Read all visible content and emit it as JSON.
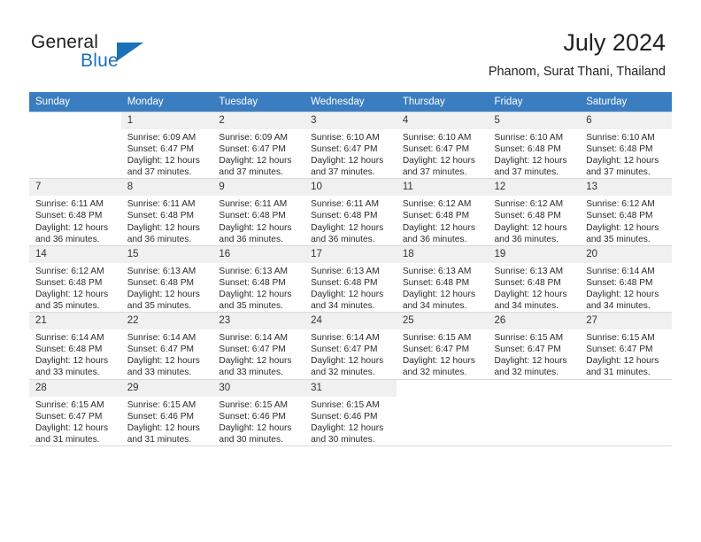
{
  "brand": {
    "word_one": "General",
    "word_two": "Blue",
    "accent_color": "#1b71b8"
  },
  "header": {
    "title": "July 2024",
    "location": "Phanom, Surat Thani, Thailand",
    "header_bg": "#3a7dc0"
  },
  "weekdays": [
    "Sunday",
    "Monday",
    "Tuesday",
    "Wednesday",
    "Thursday",
    "Friday",
    "Saturday"
  ],
  "labels": {
    "sunrise_prefix": "Sunrise:",
    "sunset_prefix": "Sunset:",
    "daylight_prefix": "Daylight:"
  },
  "weeks": [
    [
      {
        "day": "",
        "sunrise": "",
        "sunset": "",
        "daylight_line1": "",
        "daylight_line2": ""
      },
      {
        "day": "1",
        "sunrise": "Sunrise: 6:09 AM",
        "sunset": "Sunset: 6:47 PM",
        "daylight_line1": "Daylight: 12 hours",
        "daylight_line2": "and 37 minutes."
      },
      {
        "day": "2",
        "sunrise": "Sunrise: 6:09 AM",
        "sunset": "Sunset: 6:47 PM",
        "daylight_line1": "Daylight: 12 hours",
        "daylight_line2": "and 37 minutes."
      },
      {
        "day": "3",
        "sunrise": "Sunrise: 6:10 AM",
        "sunset": "Sunset: 6:47 PM",
        "daylight_line1": "Daylight: 12 hours",
        "daylight_line2": "and 37 minutes."
      },
      {
        "day": "4",
        "sunrise": "Sunrise: 6:10 AM",
        "sunset": "Sunset: 6:47 PM",
        "daylight_line1": "Daylight: 12 hours",
        "daylight_line2": "and 37 minutes."
      },
      {
        "day": "5",
        "sunrise": "Sunrise: 6:10 AM",
        "sunset": "Sunset: 6:48 PM",
        "daylight_line1": "Daylight: 12 hours",
        "daylight_line2": "and 37 minutes."
      },
      {
        "day": "6",
        "sunrise": "Sunrise: 6:10 AM",
        "sunset": "Sunset: 6:48 PM",
        "daylight_line1": "Daylight: 12 hours",
        "daylight_line2": "and 37 minutes."
      }
    ],
    [
      {
        "day": "7",
        "sunrise": "Sunrise: 6:11 AM",
        "sunset": "Sunset: 6:48 PM",
        "daylight_line1": "Daylight: 12 hours",
        "daylight_line2": "and 36 minutes."
      },
      {
        "day": "8",
        "sunrise": "Sunrise: 6:11 AM",
        "sunset": "Sunset: 6:48 PM",
        "daylight_line1": "Daylight: 12 hours",
        "daylight_line2": "and 36 minutes."
      },
      {
        "day": "9",
        "sunrise": "Sunrise: 6:11 AM",
        "sunset": "Sunset: 6:48 PM",
        "daylight_line1": "Daylight: 12 hours",
        "daylight_line2": "and 36 minutes."
      },
      {
        "day": "10",
        "sunrise": "Sunrise: 6:11 AM",
        "sunset": "Sunset: 6:48 PM",
        "daylight_line1": "Daylight: 12 hours",
        "daylight_line2": "and 36 minutes."
      },
      {
        "day": "11",
        "sunrise": "Sunrise: 6:12 AM",
        "sunset": "Sunset: 6:48 PM",
        "daylight_line1": "Daylight: 12 hours",
        "daylight_line2": "and 36 minutes."
      },
      {
        "day": "12",
        "sunrise": "Sunrise: 6:12 AM",
        "sunset": "Sunset: 6:48 PM",
        "daylight_line1": "Daylight: 12 hours",
        "daylight_line2": "and 36 minutes."
      },
      {
        "day": "13",
        "sunrise": "Sunrise: 6:12 AM",
        "sunset": "Sunset: 6:48 PM",
        "daylight_line1": "Daylight: 12 hours",
        "daylight_line2": "and 35 minutes."
      }
    ],
    [
      {
        "day": "14",
        "sunrise": "Sunrise: 6:12 AM",
        "sunset": "Sunset: 6:48 PM",
        "daylight_line1": "Daylight: 12 hours",
        "daylight_line2": "and 35 minutes."
      },
      {
        "day": "15",
        "sunrise": "Sunrise: 6:13 AM",
        "sunset": "Sunset: 6:48 PM",
        "daylight_line1": "Daylight: 12 hours",
        "daylight_line2": "and 35 minutes."
      },
      {
        "day": "16",
        "sunrise": "Sunrise: 6:13 AM",
        "sunset": "Sunset: 6:48 PM",
        "daylight_line1": "Daylight: 12 hours",
        "daylight_line2": "and 35 minutes."
      },
      {
        "day": "17",
        "sunrise": "Sunrise: 6:13 AM",
        "sunset": "Sunset: 6:48 PM",
        "daylight_line1": "Daylight: 12 hours",
        "daylight_line2": "and 34 minutes."
      },
      {
        "day": "18",
        "sunrise": "Sunrise: 6:13 AM",
        "sunset": "Sunset: 6:48 PM",
        "daylight_line1": "Daylight: 12 hours",
        "daylight_line2": "and 34 minutes."
      },
      {
        "day": "19",
        "sunrise": "Sunrise: 6:13 AM",
        "sunset": "Sunset: 6:48 PM",
        "daylight_line1": "Daylight: 12 hours",
        "daylight_line2": "and 34 minutes."
      },
      {
        "day": "20",
        "sunrise": "Sunrise: 6:14 AM",
        "sunset": "Sunset: 6:48 PM",
        "daylight_line1": "Daylight: 12 hours",
        "daylight_line2": "and 34 minutes."
      }
    ],
    [
      {
        "day": "21",
        "sunrise": "Sunrise: 6:14 AM",
        "sunset": "Sunset: 6:48 PM",
        "daylight_line1": "Daylight: 12 hours",
        "daylight_line2": "and 33 minutes."
      },
      {
        "day": "22",
        "sunrise": "Sunrise: 6:14 AM",
        "sunset": "Sunset: 6:47 PM",
        "daylight_line1": "Daylight: 12 hours",
        "daylight_line2": "and 33 minutes."
      },
      {
        "day": "23",
        "sunrise": "Sunrise: 6:14 AM",
        "sunset": "Sunset: 6:47 PM",
        "daylight_line1": "Daylight: 12 hours",
        "daylight_line2": "and 33 minutes."
      },
      {
        "day": "24",
        "sunrise": "Sunrise: 6:14 AM",
        "sunset": "Sunset: 6:47 PM",
        "daylight_line1": "Daylight: 12 hours",
        "daylight_line2": "and 32 minutes."
      },
      {
        "day": "25",
        "sunrise": "Sunrise: 6:15 AM",
        "sunset": "Sunset: 6:47 PM",
        "daylight_line1": "Daylight: 12 hours",
        "daylight_line2": "and 32 minutes."
      },
      {
        "day": "26",
        "sunrise": "Sunrise: 6:15 AM",
        "sunset": "Sunset: 6:47 PM",
        "daylight_line1": "Daylight: 12 hours",
        "daylight_line2": "and 32 minutes."
      },
      {
        "day": "27",
        "sunrise": "Sunrise: 6:15 AM",
        "sunset": "Sunset: 6:47 PM",
        "daylight_line1": "Daylight: 12 hours",
        "daylight_line2": "and 31 minutes."
      }
    ],
    [
      {
        "day": "28",
        "sunrise": "Sunrise: 6:15 AM",
        "sunset": "Sunset: 6:47 PM",
        "daylight_line1": "Daylight: 12 hours",
        "daylight_line2": "and 31 minutes."
      },
      {
        "day": "29",
        "sunrise": "Sunrise: 6:15 AM",
        "sunset": "Sunset: 6:46 PM",
        "daylight_line1": "Daylight: 12 hours",
        "daylight_line2": "and 31 minutes."
      },
      {
        "day": "30",
        "sunrise": "Sunrise: 6:15 AM",
        "sunset": "Sunset: 6:46 PM",
        "daylight_line1": "Daylight: 12 hours",
        "daylight_line2": "and 30 minutes."
      },
      {
        "day": "31",
        "sunrise": "Sunrise: 6:15 AM",
        "sunset": "Sunset: 6:46 PM",
        "daylight_line1": "Daylight: 12 hours",
        "daylight_line2": "and 30 minutes."
      },
      {
        "day": "",
        "sunrise": "",
        "sunset": "",
        "daylight_line1": "",
        "daylight_line2": ""
      },
      {
        "day": "",
        "sunrise": "",
        "sunset": "",
        "daylight_line1": "",
        "daylight_line2": ""
      },
      {
        "day": "",
        "sunrise": "",
        "sunset": "",
        "daylight_line1": "",
        "daylight_line2": ""
      }
    ]
  ]
}
